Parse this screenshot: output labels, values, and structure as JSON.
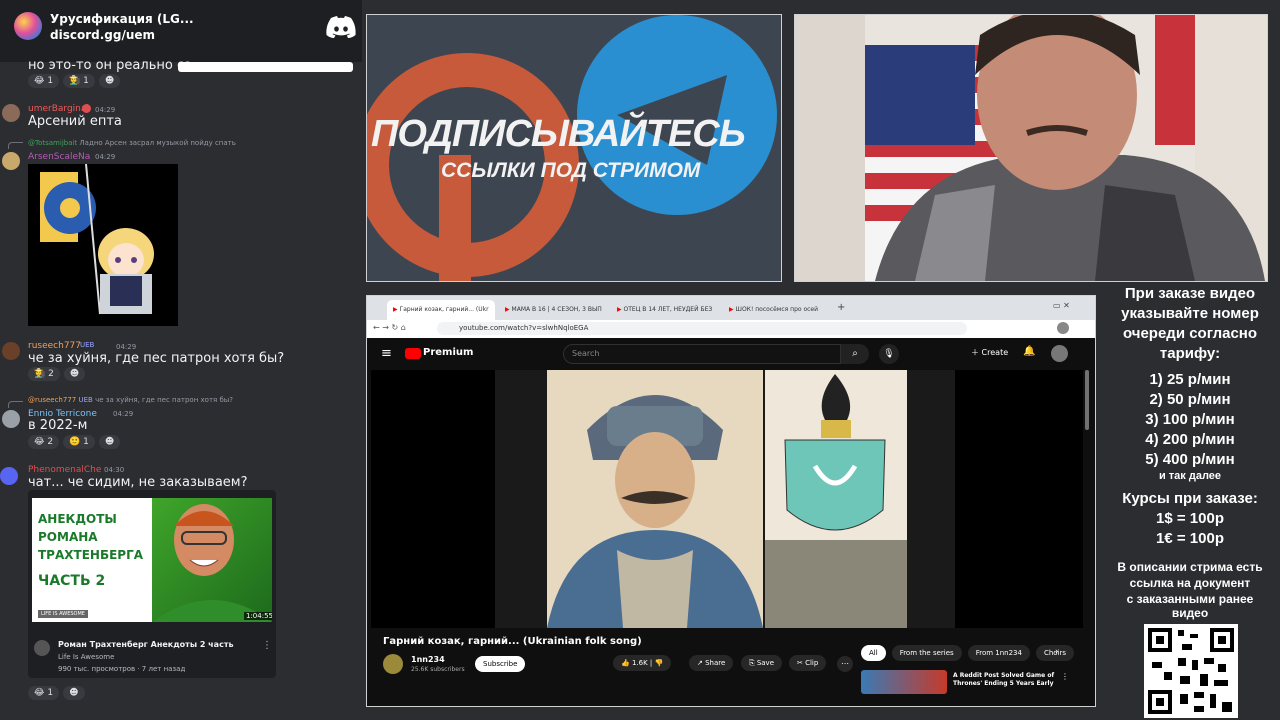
{
  "discord": {
    "server_name": "Урусификация (LG...",
    "invite": "discord.gg/uem",
    "messages": [
      {
        "text": "но это-то он реально са",
        "reactions": [
          "😂 1",
          "👨‍🌾 1",
          "☻"
        ]
      },
      {
        "user": "umerBarginal",
        "time": "04:29",
        "text": "Арсений епта"
      },
      {
        "reply_user": "@Totsamijbait",
        "reply_text": "Ладно Арсен засрал музыкой пойду спать",
        "user": "ArsenScaleNa",
        "time": "04:29"
      },
      {
        "user": "ruseech777",
        "tag": "UEB",
        "time": "04:29",
        "text": "че за хуйня, где пес патрон хотя бы?",
        "reactions": [
          "🧑‍🌾 2",
          "☻"
        ]
      },
      {
        "reply_user": "@ruseech777",
        "reply_tag": "UEB",
        "reply_text": "че за хуйня, где пес патрон хотя бы?",
        "user": "Ennio Terricone",
        "time": "04:29",
        "text": "в 2022-м",
        "reactions": [
          "😂 2",
          "🙂 1",
          "☻"
        ]
      },
      {
        "user": "PhenomenalChe",
        "time": "04:30",
        "text": "чат... че сидим, не заказываем?",
        "reactions": [
          "😂 1",
          "☻"
        ]
      }
    ],
    "embed": {
      "thumb_text_1": "АНЕКДОТЫ",
      "thumb_text_2": "РОМАНА",
      "thumb_text_3": "ТРАХТЕНБЕРГА",
      "thumb_text_4": "ЧАСТЬ 2",
      "channel_badge": "LIFE IS AWESOME",
      "duration": "1:04:55",
      "title": "Роман Трахтенберг Анекдоты 2 часть",
      "channel": "Life Is Awesome",
      "meta": "990 тыс. просмотров · 7 лет назад"
    }
  },
  "promo": {
    "headline": "ПОДПИСЫВАЙТЕСЬ",
    "subline": "ССЫЛКИ ПОД СТРИМОМ",
    "bg_color": "#3d4650"
  },
  "browser": {
    "tabs": [
      "Гарний козак, гарний... (Ukr",
      "МАМА В 16 | 4 СЕЗОН, 3 ВЫП",
      "ОТЕЦ В 14 ЛЕТ, НЕУДЕЙ БЕЗ",
      "ШОК! пососёмся про осей"
    ],
    "url": "youtube.com/watch?v=slwhNqloEGA",
    "yt": {
      "brand": "Premium",
      "search_placeholder": "Search",
      "create_label": "Create",
      "video_title": "Гарний козак, гарний... (Ukrainian folk song)",
      "channel": "1nn234",
      "subs": "25.6K subscribers",
      "subscribe": "Subscribe",
      "likes": "1.6K",
      "share": "Share",
      "save": "Save",
      "clip": "Clip",
      "chips": [
        "All",
        "From the series",
        "From 1nn234",
        "Choirs"
      ],
      "suggested_title": "A Reddit Post Solved Game of Thrones' Ending 5 Years Early"
    }
  },
  "info": {
    "lines": [
      "При заказе видео",
      "указывайте номер",
      "очереди согласно",
      "тарифу:"
    ],
    "tariffs": [
      "1) 25 р/мин",
      "2) 50 р/мин",
      "3) 100 р/мин",
      "4) 200 р/мин",
      "5) 400 р/мин"
    ],
    "etc": "и так далее",
    "courses_title": "Курсы при заказе:",
    "courses": [
      "1$ = 100р",
      "1€ = 100р"
    ],
    "desc_lines": [
      "В описании стрима есть",
      "ссылка на документ",
      "с заказанными ранее",
      "видео"
    ]
  }
}
